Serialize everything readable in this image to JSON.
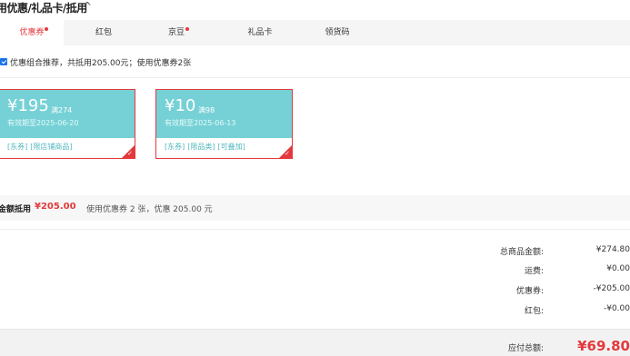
{
  "header": {
    "title": "用优惠/礼品卡/抵用",
    "toggle_icon": "chevron-up"
  },
  "tabs": [
    {
      "label": "优惠券",
      "active": true,
      "dot": true
    },
    {
      "label": "红包",
      "active": false,
      "dot": false
    },
    {
      "label": "京豆",
      "active": false,
      "dot": true
    },
    {
      "label": "礼品卡",
      "active": false,
      "dot": false
    },
    {
      "label": "领货码",
      "active": false,
      "dot": false
    }
  ],
  "recommend": {
    "checked": true,
    "text": "优惠组合推荐，共抵用205.00元；使用优惠券2张"
  },
  "coupons": [
    {
      "currency": "¥",
      "amount": "195",
      "condition": "满274",
      "expire": "有效期至2025-06-20",
      "tags": [
        "[东券]",
        "[限店铺商品]"
      ],
      "selected": true
    },
    {
      "currency": "¥",
      "amount": "10",
      "condition": "满98",
      "expire": "有效期至2025-06-13",
      "tags": [
        "[东券]",
        "[限品类]",
        "[可叠加]"
      ],
      "selected": true
    }
  ],
  "summary": {
    "label": "金额抵用",
    "amount": "¥205.00",
    "desc": "使用优惠券 2 张，优惠 205.00 元"
  },
  "totals": [
    {
      "label": "总商品金额:",
      "value": "¥274.80"
    },
    {
      "label": "运费:",
      "value": "¥0.00"
    },
    {
      "label": "优惠券:",
      "value": "-¥205.00"
    },
    {
      "label": "红包:",
      "value": "-¥0.00"
    }
  ],
  "pay": {
    "label": "应付总额:",
    "value": "¥69.80"
  },
  "colors": {
    "accent": "#e4393c",
    "coupon_bg": "#76d1d6",
    "coupon_tag": "#52b7bd"
  }
}
